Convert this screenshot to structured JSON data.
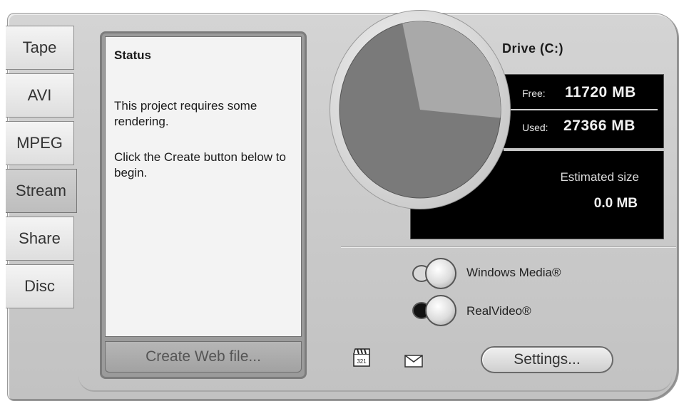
{
  "tabs": [
    {
      "label": "Tape"
    },
    {
      "label": "AVI"
    },
    {
      "label": "MPEG"
    },
    {
      "label": "Stream",
      "active": true
    },
    {
      "label": "Share"
    },
    {
      "label": "Disc"
    }
  ],
  "status": {
    "title": "Status",
    "line1": "This project requires some rendering.",
    "line2": "Click the Create button below to begin.",
    "create_button": "Create Web file..."
  },
  "drive": {
    "label": "Drive (C:)",
    "free_label": "Free:",
    "free_value": "11720 MB",
    "used_label": "Used:",
    "used_value": "27366 MB",
    "estimated_label": "Estimated size",
    "estimated_value": "0.0 MB",
    "free_mb": 11720,
    "used_mb": 27366,
    "colors": {
      "free": "#a9a9a9",
      "used": "#7a7a7a"
    }
  },
  "formats": [
    {
      "label": "Windows Media®",
      "selected": false
    },
    {
      "label": "RealVideo®",
      "selected": true
    }
  ],
  "footer": {
    "settings_button": "Settings...",
    "icons": [
      "clapper-icon",
      "mail-icon"
    ]
  }
}
